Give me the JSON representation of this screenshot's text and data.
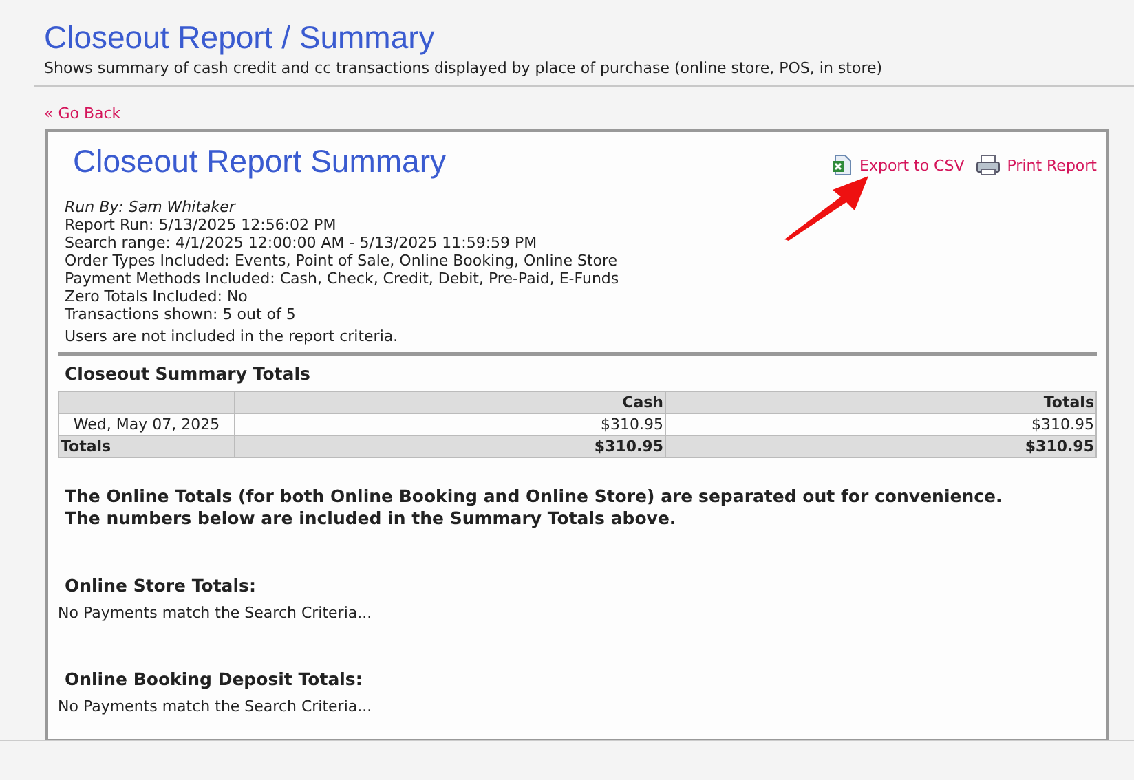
{
  "page": {
    "title": "Closeout Report / Summary",
    "subtitle": "Shows summary of cash credit and cc transactions displayed by place of purchase (online store, POS, in store)"
  },
  "back_link": "« Go Back",
  "report": {
    "title": "Closeout Report Summary",
    "actions": [
      {
        "kind": "csv",
        "label": "Export to CSV"
      },
      {
        "kind": "print",
        "label": "Print Report"
      }
    ],
    "run_by": "Run By: Sam Whitaker",
    "details": [
      "Report Run: 5/13/2025 12:56:02 PM",
      "Search range: 4/1/2025 12:00:00 AM - 5/13/2025 11:59:59 PM",
      "Order Types Included: Events, Point of Sale, Online Booking, Online Store",
      "Payment Methods Included: Cash, Check, Credit, Debit, Pre-Paid, E-Funds",
      "Zero Totals Included: No",
      "Transactions shown: 5 out of 5"
    ],
    "criteria_note": "Users are not included in the report criteria.",
    "summary": {
      "title": "Closeout Summary Totals",
      "columns": [
        "Cash",
        "Totals"
      ],
      "rows": [
        {
          "label": "Wed, May 07, 2025",
          "values": [
            "$310.95",
            "$310.95"
          ]
        }
      ],
      "totals": {
        "label": "Totals",
        "values": [
          "$310.95",
          "$310.95"
        ]
      }
    },
    "online_note": [
      "The Online Totals (for both Online Booking and Online Store) are separated out for convenience.",
      "The numbers below are included in the Summary Totals above."
    ],
    "sections": [
      {
        "title": "Online Store Totals:",
        "message": "No Payments match the Search Criteria..."
      },
      {
        "title": "Online Booking Deposit Totals:",
        "message": "No Payments match the Search Criteria..."
      }
    ]
  }
}
